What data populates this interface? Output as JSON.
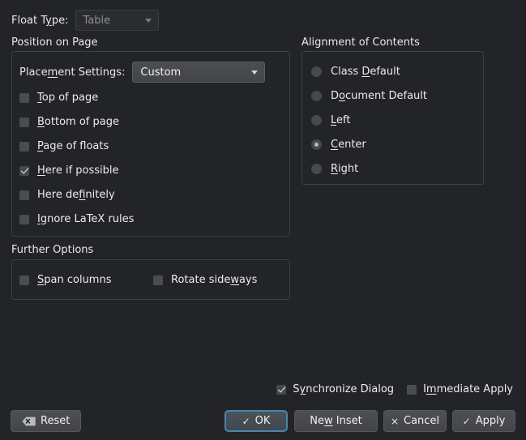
{
  "float_type": {
    "label_pre": "Float T",
    "label_mnemonic": "y",
    "label_post": "pe:",
    "value": "Table",
    "enabled": false,
    "arrow_icon": "chevron-down-icon"
  },
  "position_group": {
    "title": "Position on Page",
    "placement": {
      "label_pre": "Place",
      "label_mnemonic": "m",
      "label_post": "ent Settings:",
      "value": "Custom",
      "arrow_icon": "chevron-down-icon"
    },
    "checkboxes": [
      {
        "pre": "",
        "mnemonic": "T",
        "post": "op of page",
        "checked": false
      },
      {
        "pre": "",
        "mnemonic": "B",
        "post": "ottom of page",
        "checked": false
      },
      {
        "pre": "",
        "mnemonic": "P",
        "post": "age of floats",
        "checked": false
      },
      {
        "pre": "",
        "mnemonic": "H",
        "post": "ere if possible",
        "checked": true
      },
      {
        "pre": "Here de",
        "mnemonic": "f",
        "post": "initely",
        "checked": false
      },
      {
        "pre": "",
        "mnemonic": "I",
        "post": "gnore LaTeX rules",
        "checked": false
      }
    ]
  },
  "alignment_group": {
    "title": "Alignment of Contents",
    "radios": [
      {
        "pre": "Class ",
        "mnemonic": "D",
        "post": "efault",
        "selected": false
      },
      {
        "pre": "D",
        "mnemonic": "o",
        "post": "cument Default",
        "selected": false
      },
      {
        "pre": "",
        "mnemonic": "L",
        "post": "eft",
        "selected": false
      },
      {
        "pre": "",
        "mnemonic": "C",
        "post": "enter",
        "selected": true
      },
      {
        "pre": "",
        "mnemonic": "R",
        "post": "ight",
        "selected": false
      }
    ]
  },
  "further_group": {
    "title": "Further Options",
    "checkboxes": [
      {
        "pre": "",
        "mnemonic": "S",
        "post": "pan columns",
        "checked": false
      },
      {
        "pre": "Rotate side",
        "mnemonic": "w",
        "post": "ays",
        "checked": false
      }
    ]
  },
  "bottom_options": [
    {
      "pre": "S",
      "mnemonic": "y",
      "post": "nchronize Dialog",
      "checked": true
    },
    {
      "pre": "I",
      "mnemonic": "m",
      "post": "mediate Apply",
      "checked": false
    }
  ],
  "buttons": {
    "reset": {
      "label": "Reset",
      "icon": "backspace-icon"
    },
    "ok": {
      "label": "OK",
      "glyph": "✓",
      "icon": "check-icon",
      "focused": true
    },
    "new_inset": {
      "pre": "Ne",
      "mnemonic": "w",
      "post": " Inset"
    },
    "cancel": {
      "label": "Cancel",
      "glyph": "×",
      "icon": "close-icon"
    },
    "apply": {
      "label": "Apply",
      "glyph": "✓",
      "icon": "check-icon"
    }
  },
  "colors": {
    "background": "#232427",
    "text": "#e9e9e9",
    "group_border": "#3e4044",
    "control_fill": "#4a4c50",
    "focus_blue": "#4a84b0",
    "disabled_text": "#8d8f92"
  }
}
